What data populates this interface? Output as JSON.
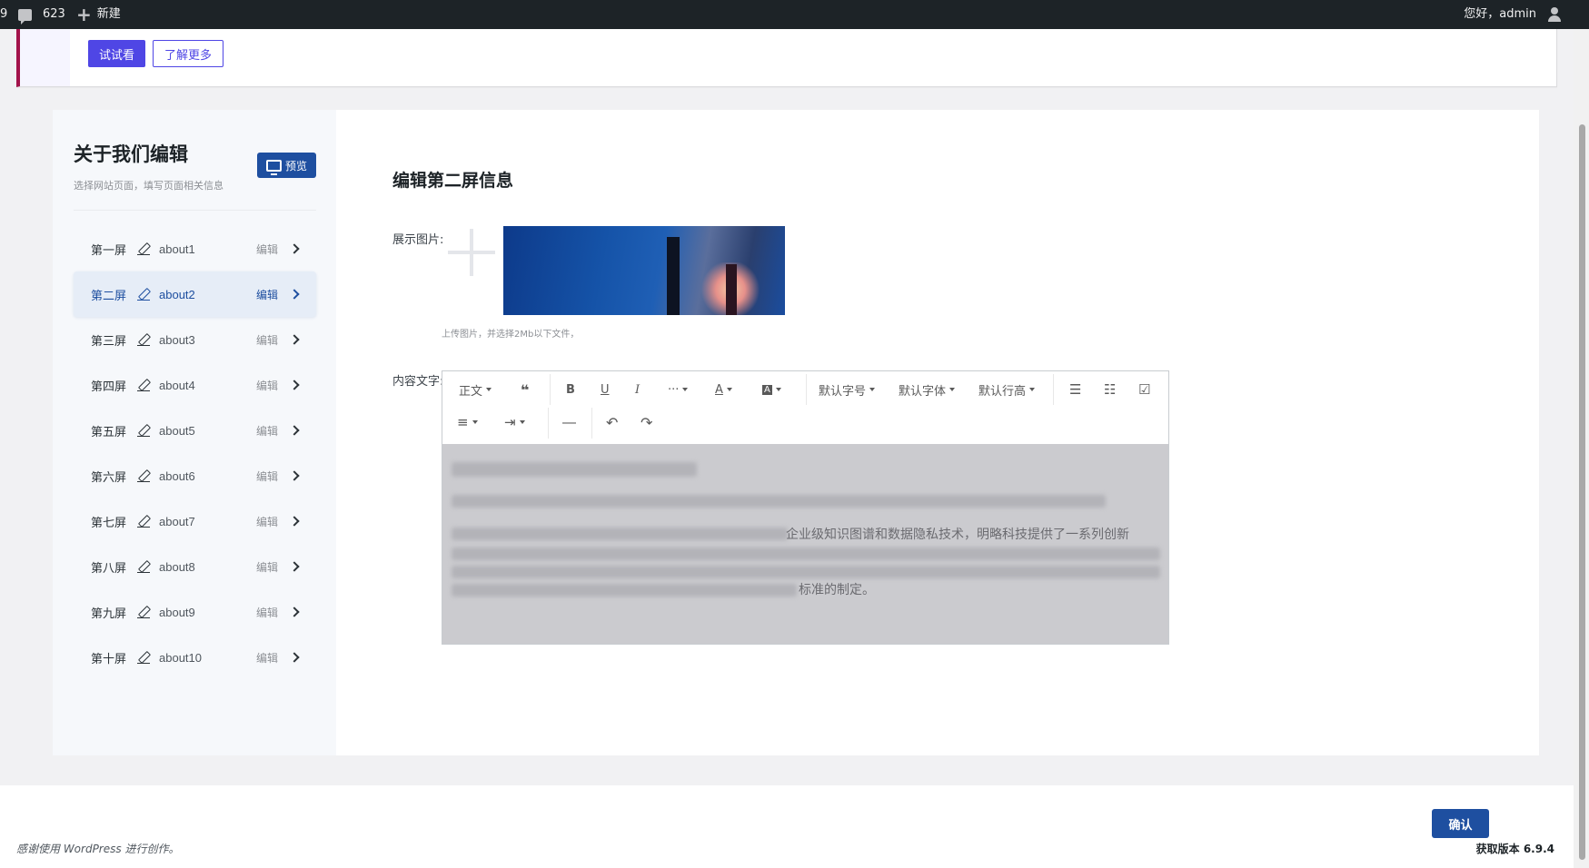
{
  "adminbar": {
    "left_fragment": "9",
    "comments_count": "623",
    "new_label": "新建",
    "greeting": "您好，admin"
  },
  "notice": {
    "try_label": "试试看",
    "more_label": "了解更多"
  },
  "sidebar": {
    "title": "关于我们编辑",
    "subtitle": "选择网站页面，填写页面相关信息",
    "preview_label": "预览",
    "items": [
      {
        "name": "第一屏",
        "slug": "about1",
        "edit": "编辑"
      },
      {
        "name": "第二屏",
        "slug": "about2",
        "edit": "编辑"
      },
      {
        "name": "第三屏",
        "slug": "about3",
        "edit": "编辑"
      },
      {
        "name": "第四屏",
        "slug": "about4",
        "edit": "编辑"
      },
      {
        "name": "第五屏",
        "slug": "about5",
        "edit": "编辑"
      },
      {
        "name": "第六屏",
        "slug": "about6",
        "edit": "编辑"
      },
      {
        "name": "第七屏",
        "slug": "about7",
        "edit": "编辑"
      },
      {
        "name": "第八屏",
        "slug": "about8",
        "edit": "编辑"
      },
      {
        "name": "第九屏",
        "slug": "about9",
        "edit": "编辑"
      },
      {
        "name": "第十屏",
        "slug": "about10",
        "edit": "编辑"
      }
    ],
    "active_index": 1
  },
  "main": {
    "section_title": "编辑第二屏信息",
    "image_label": "展示图片:",
    "upload_hint": "上传图片，并选择2Mb以下文件，",
    "content_label": "内容文字:"
  },
  "editor": {
    "toolbar": {
      "paragraph": "正文",
      "quote": "❝",
      "bold": "B",
      "underline": "U",
      "italic": "I",
      "more": "···",
      "font_color": "A",
      "bg_color": "A",
      "font_size": "默认字号",
      "font_family": "默认字体",
      "line_height": "默认行高",
      "bullet_list": "☰",
      "numbered_list": "☷",
      "todo": "☑",
      "align": "≡",
      "indent": "⇥",
      "divider": "―",
      "undo": "↶",
      "redo": "↷"
    },
    "visible_text": {
      "fragment1": "企业级知识图谱和数据隐私技术，明略科技提供了一系列创新",
      "fragment2": "标准的制定。"
    }
  },
  "footer": {
    "confirm_label": "确认",
    "thanks": "感谢使用 WordPress 进行创作。",
    "version": "获取版本 6.9.4"
  },
  "colors": {
    "adminbar_bg": "#1d2327",
    "primary": "#1e4fa0",
    "notice_button": "#4f46e5",
    "notice_accent": "#a2134a"
  }
}
